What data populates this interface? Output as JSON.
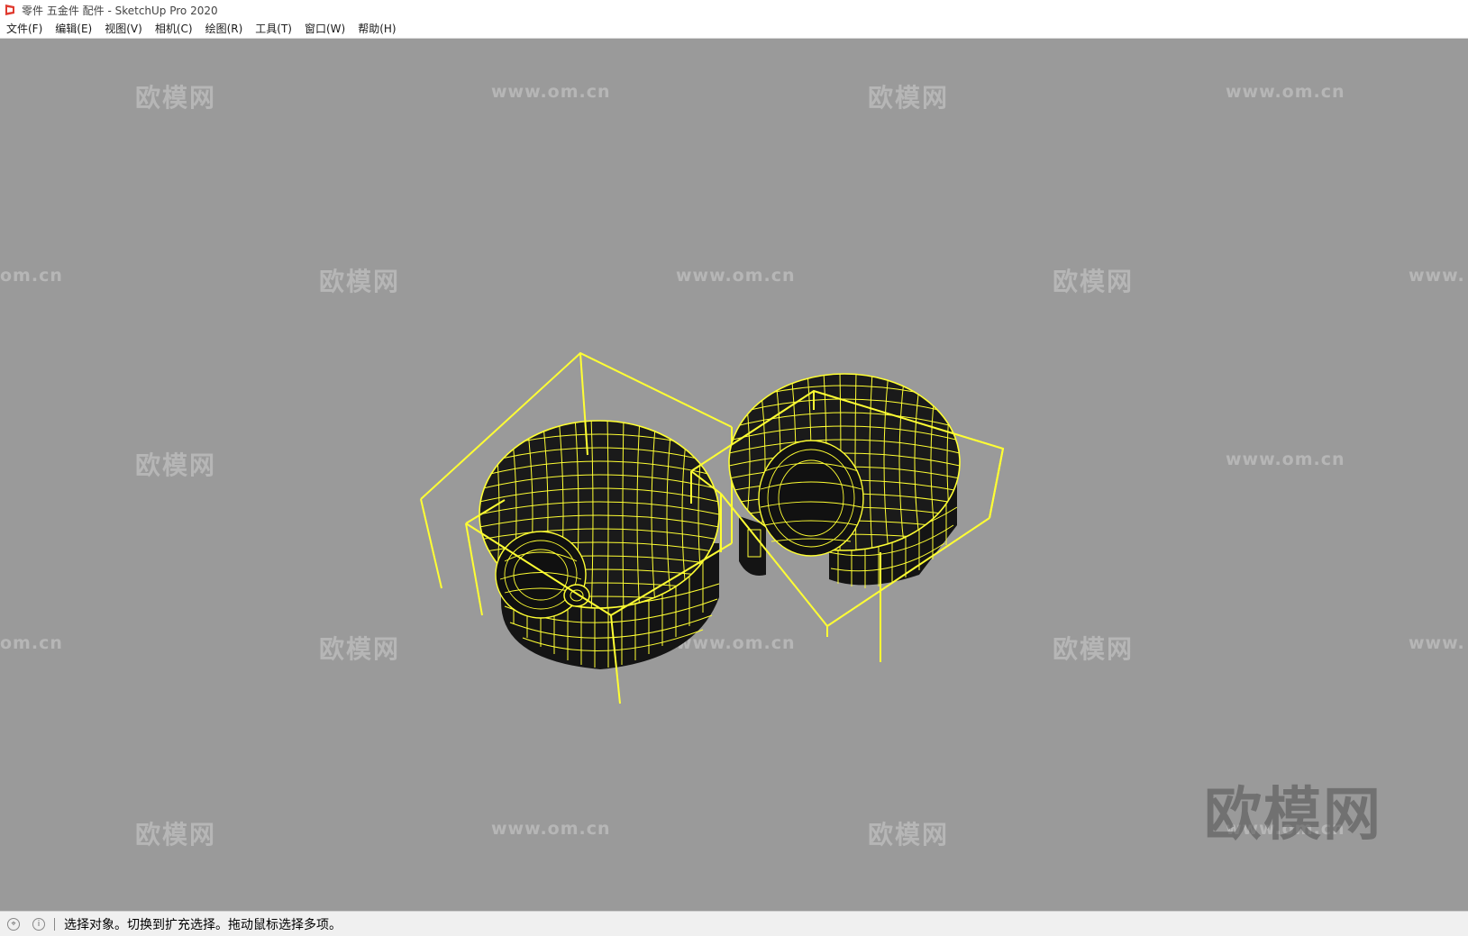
{
  "window": {
    "title": "零件 五金件 配件 - SketchUp Pro 2020"
  },
  "menu": [
    {
      "label": "文件(F)"
    },
    {
      "label": "编辑(E)"
    },
    {
      "label": "视图(V)"
    },
    {
      "label": "相机(C)"
    },
    {
      "label": "绘图(R)"
    },
    {
      "label": "工具(T)"
    },
    {
      "label": "窗口(W)"
    },
    {
      "label": "帮助(H)"
    }
  ],
  "viewport": {
    "background_color": "#9a9a9a",
    "selection_color": "#ffff33",
    "model_color": "#111111",
    "objects": [
      "caster-wheel-left",
      "caster-wheel-right"
    ]
  },
  "watermarks": {
    "cn": "欧模网",
    "url": "www.om.cn",
    "url_partial_left": "om.cn",
    "url_partial_right": "www."
  },
  "status": {
    "geo_icon": "location-icon",
    "info_icon": "info-icon",
    "message": "选择对象。切换到扩充选择。拖动鼠标选择多项。"
  }
}
